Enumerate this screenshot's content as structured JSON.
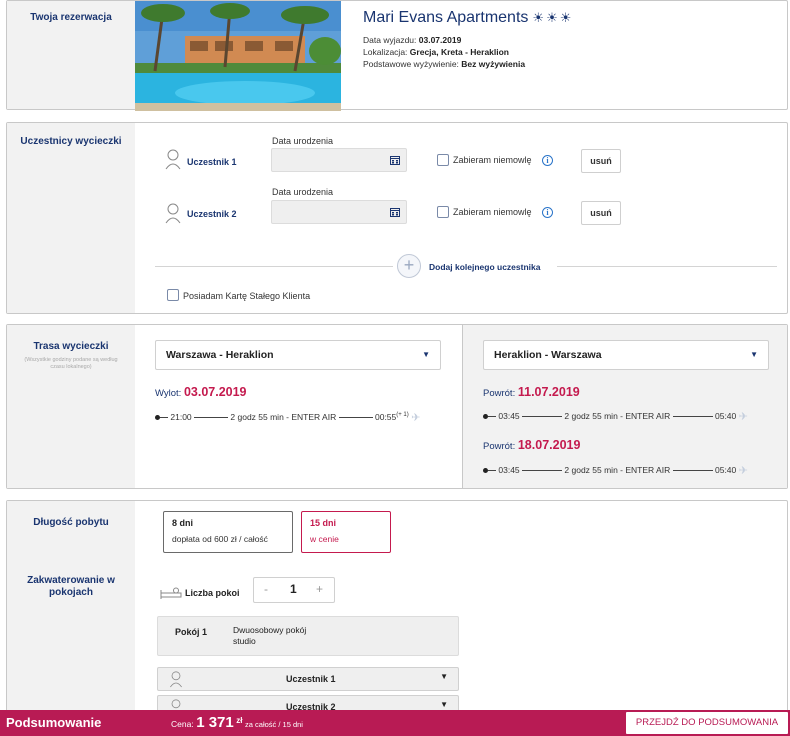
{
  "reservation": {
    "section_title": "Twoja rezerwacja",
    "hotel_name": "Mari Evans Apartments",
    "stars_icon": "sun-icon",
    "rating_stars": 3,
    "departure_label": "Data wyjazdu:",
    "departure_value": "03.07.2019",
    "location_label": "Lokalizacja:",
    "location_value": "Grecja, Kreta - Heraklion",
    "board_label": "Podstawowe wyżywienie:",
    "board_value": "Bez wyżywienia"
  },
  "participants": {
    "section_title": "Uczestnicy wycieczki",
    "items": [
      {
        "label": "Uczestnik 1",
        "birth_label": "Data urodzenia",
        "birth_value": "",
        "infant_label": "Zabieram niemowlę",
        "remove_label": "usuń"
      },
      {
        "label": "Uczestnik 2",
        "birth_label": "Data urodzenia",
        "birth_value": "",
        "infant_label": "Zabieram niemowlę",
        "remove_label": "usuń"
      }
    ],
    "add_label": "Dodaj kolejnego uczestnika",
    "card_label": "Posiadam Kartę Stałego Klienta"
  },
  "route": {
    "section_title": "Trasa wycieczki",
    "section_note": "(Wszystkie godziny podane są według czasu lokalnego)",
    "outbound": {
      "select_value": "Warszawa - Heraklion",
      "date_label": "Wylot:",
      "date": "03.07.2019",
      "flight": {
        "dep": "21:00",
        "info": "2 godz 55 min - ENTER AIR",
        "arr": "00:55",
        "arr_note": "(+ 1)"
      }
    },
    "inbound": {
      "select_value": "Heraklion - Warszawa",
      "returns": [
        {
          "date_label": "Powrót:",
          "date": "11.07.2019",
          "dep": "03:45",
          "info": "2 godz 55 min - ENTER AIR",
          "arr": "05:40"
        },
        {
          "date_label": "Powrót:",
          "date": "18.07.2019",
          "dep": "03:45",
          "info": "2 godz 55 min - ENTER AIR",
          "arr": "05:40"
        }
      ]
    }
  },
  "stay": {
    "section_title": "Długość pobytu",
    "options": [
      {
        "title": "8 dni",
        "sub": "dopłata od 600 zł / całość"
      },
      {
        "title": "15 dni",
        "sub": "w cenie"
      }
    ],
    "rooms_title": "Zakwaterowanie w pokojach",
    "rooms_count_label": "Liczba pokoi",
    "rooms_count": "1",
    "minus": "-",
    "plus": "+",
    "room_label": "Pokój 1",
    "room_type": "Dwuosobowy pokój studio",
    "assign": [
      "Uczestnik 1",
      "Uczestnik 2"
    ]
  },
  "summary": {
    "title": "Podsumowanie",
    "price_label": "Cena:",
    "price_value": "1 371",
    "price_currency": "zł",
    "price_suffix": "za całość / 15 dni",
    "button_label": "PRZEJDŹ DO PODSUMOWANIA"
  },
  "colors": {
    "brand": "#b81b54",
    "navy": "#1a3570",
    "accent_red": "#c41a4e",
    "sidebar": "#f2f2f2"
  }
}
